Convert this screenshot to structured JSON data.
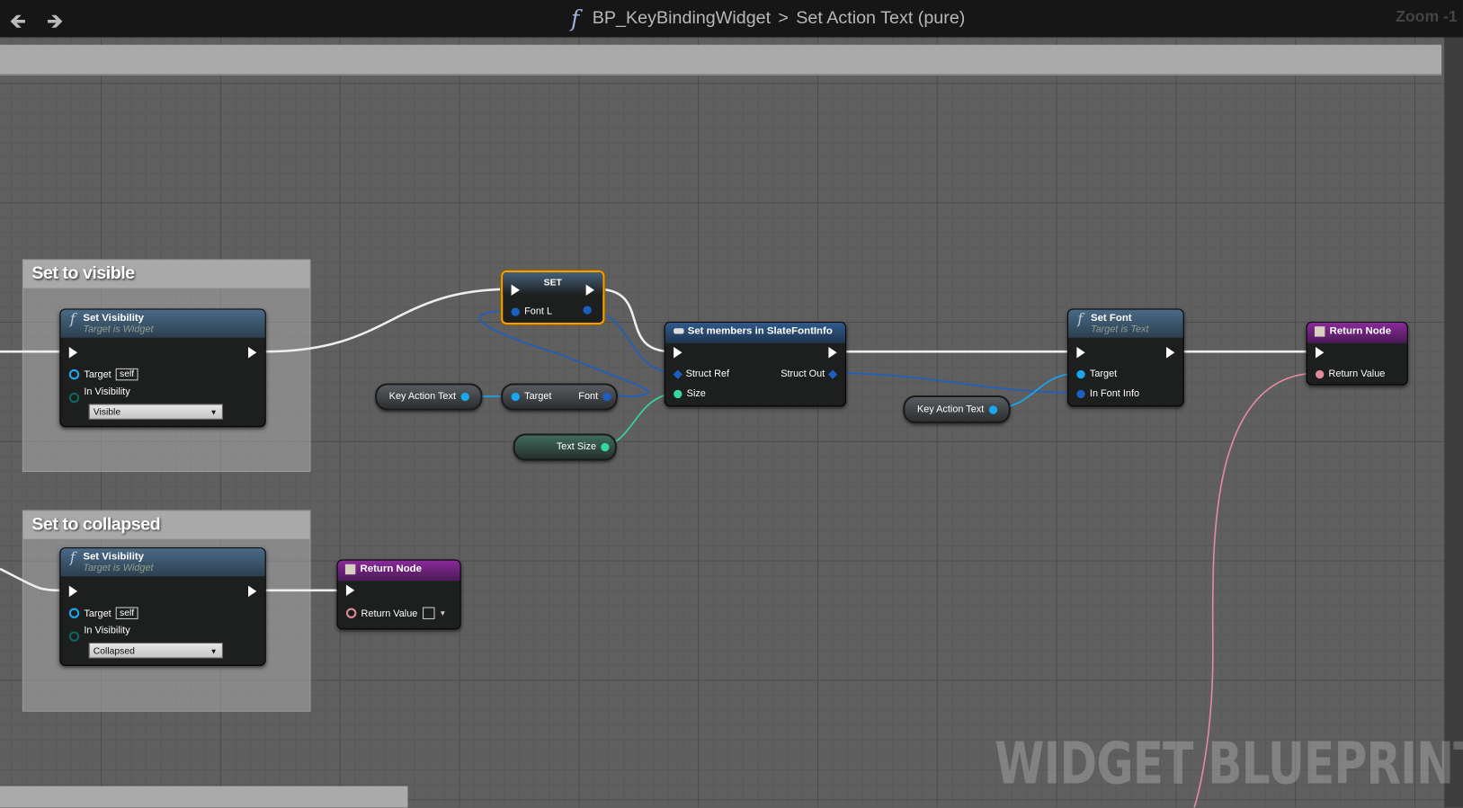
{
  "header": {
    "back": "back-arrow",
    "forward": "forward-arrow",
    "blueprint": "BP_KeyBindingWidget",
    "separator": ">",
    "function": "Set Action Text (pure)",
    "zoom": "Zoom -1"
  },
  "comments": [
    {
      "title": "Set to visible"
    },
    {
      "title": "Set to collapsed"
    }
  ],
  "set_visibility_1": {
    "title": "Set Visibility",
    "subtitle": "Target is Widget",
    "target": "Target",
    "self": "self",
    "in_visibility": "In Visibility",
    "value": "Visible"
  },
  "set_visibility_2": {
    "title": "Set Visibility",
    "subtitle": "Target is Widget",
    "target": "Target",
    "self": "self",
    "in_visibility": "In Visibility",
    "value": "Collapsed"
  },
  "set_node": {
    "title": "SET",
    "pin": "Font L"
  },
  "key_action_text_1": "Key Action Text",
  "get_font": {
    "target": "Target",
    "font": "Font"
  },
  "text_size": "Text Size",
  "set_members": {
    "title": "Set members in SlateFontInfo",
    "struct_ref": "Struct Ref",
    "struct_out": "Struct Out",
    "size": "Size"
  },
  "key_action_text_2": "Key Action Text",
  "set_font": {
    "title": "Set Font",
    "subtitle": "Target is Text",
    "target": "Target",
    "in_font_info": "In Font Info"
  },
  "return_node_1": {
    "title": "Return Node",
    "return_value": "Return Value"
  },
  "return_node_2": {
    "title": "Return Node",
    "return_value": "Return Value"
  },
  "watermark": "WIDGET BLUEPRINT",
  "colors": {
    "exec": "#ffffff",
    "object": "#00a8f0",
    "struct": "#0a5fd0",
    "float": "#35d6a0",
    "bool": "#e0829a",
    "highlight": "#f0a000"
  }
}
